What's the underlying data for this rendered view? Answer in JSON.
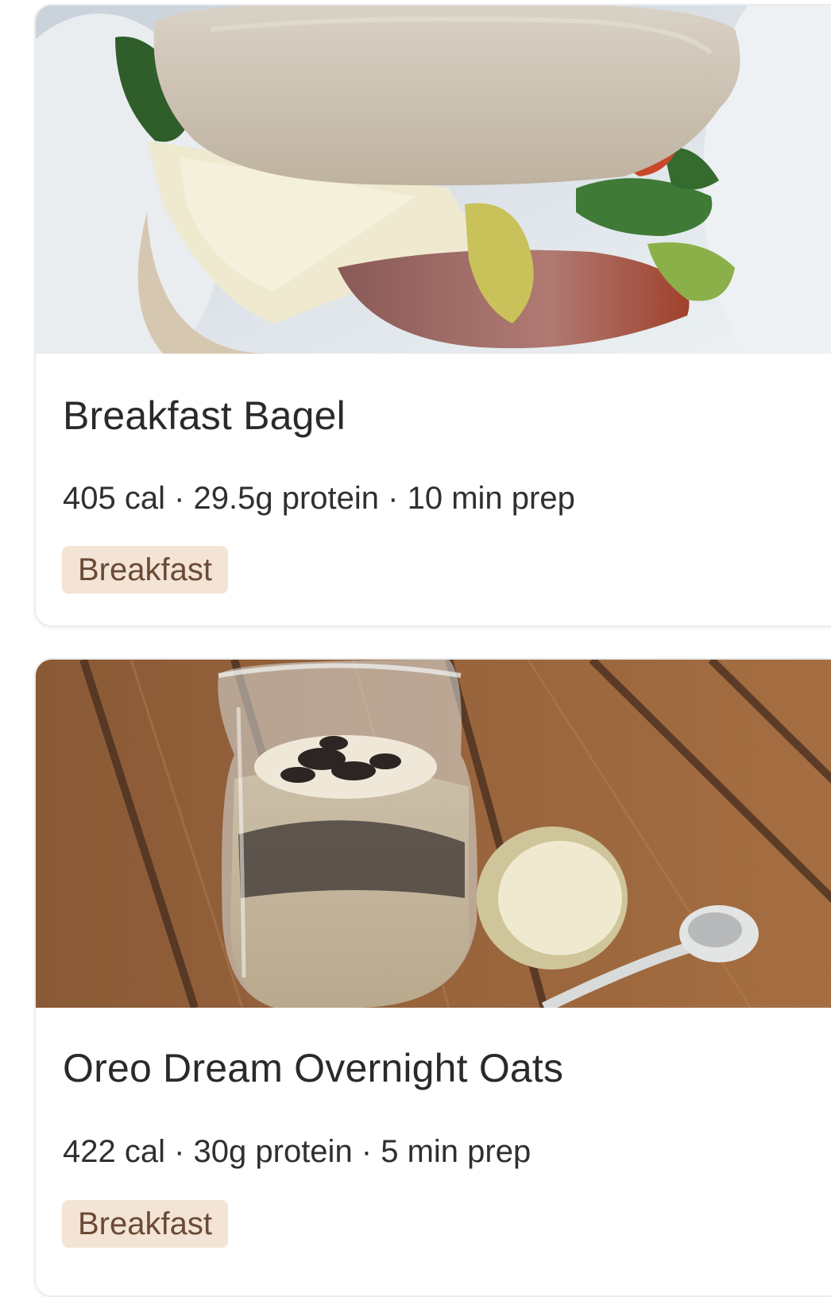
{
  "recipes": [
    {
      "title": "Breakfast Bagel",
      "meta": "405 cal · 29.5g protein · 10 min prep",
      "tag": "Breakfast",
      "image": "breakfast-bagel-photo"
    },
    {
      "title": "Oreo Dream Overnight Oats",
      "meta": "422 cal · 30g protein · 5 min prep",
      "tag": "Breakfast",
      "image": "overnight-oats-jar-photo"
    }
  ],
  "colors": {
    "tag_background": "#f3e4d6",
    "tag_text": "#6a4a36",
    "title_text": "#2a2a2a",
    "card_border": "#ececec"
  }
}
